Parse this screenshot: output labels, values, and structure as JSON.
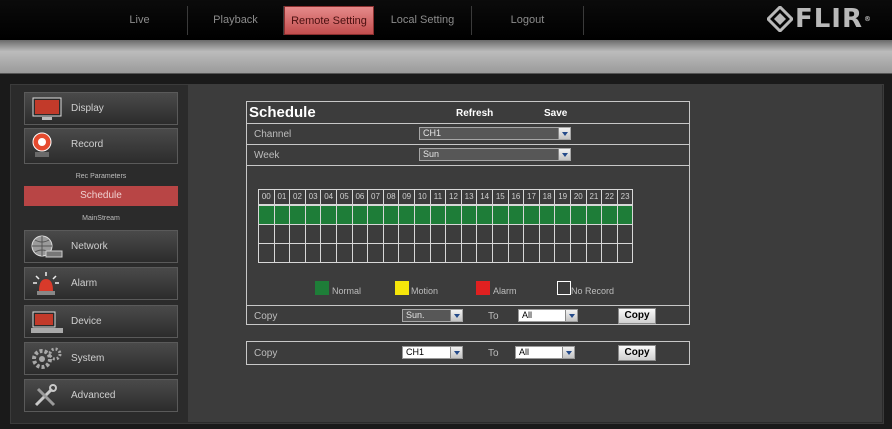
{
  "nav": {
    "tabs": [
      {
        "label": "Live"
      },
      {
        "label": "Playback"
      },
      {
        "label": "Remote Setting"
      },
      {
        "label": "Local Setting"
      },
      {
        "label": "Logout"
      }
    ],
    "active_tab": "Remote Setting",
    "logo_text": "FLIR",
    "logo_mark": "®"
  },
  "sidebar": {
    "items": [
      {
        "label": "Display",
        "icon": "monitor-icon"
      },
      {
        "label": "Record",
        "icon": "record-icon"
      },
      {
        "label": "Network",
        "icon": "globe-network-icon"
      },
      {
        "label": "Alarm",
        "icon": "alarm-siren-icon"
      },
      {
        "label": "Device",
        "icon": "device-icon"
      },
      {
        "label": "System",
        "icon": "gears-icon"
      },
      {
        "label": "Advanced",
        "icon": "tools-icon"
      }
    ],
    "record_sub": [
      {
        "label": "Rec Parameters"
      },
      {
        "label": "Schedule"
      },
      {
        "label": "MainStream"
      }
    ],
    "active_sub": "Schedule"
  },
  "schedule": {
    "title": "Schedule",
    "refresh_label": "Refresh",
    "save_label": "Save",
    "channel_label": "Channel",
    "channel_value": "CH1",
    "week_label": "Week",
    "week_value": "Sun",
    "hours": [
      "00",
      "01",
      "02",
      "03",
      "04",
      "05",
      "06",
      "07",
      "08",
      "09",
      "10",
      "11",
      "12",
      "13",
      "14",
      "15",
      "16",
      "17",
      "18",
      "19",
      "20",
      "21",
      "22",
      "23"
    ],
    "rows": [
      [
        "Normal",
        "Normal",
        "Normal",
        "Normal",
        "Normal",
        "Normal",
        "Normal",
        "Normal",
        "Normal",
        "Normal",
        "Normal",
        "Normal",
        "Normal",
        "Normal",
        "Normal",
        "Normal",
        "Normal",
        "Normal",
        "Normal",
        "Normal",
        "Normal",
        "Normal",
        "Normal",
        "Normal"
      ],
      [
        "No Record",
        "No Record",
        "No Record",
        "No Record",
        "No Record",
        "No Record",
        "No Record",
        "No Record",
        "No Record",
        "No Record",
        "No Record",
        "No Record",
        "No Record",
        "No Record",
        "No Record",
        "No Record",
        "No Record",
        "No Record",
        "No Record",
        "No Record",
        "No Record",
        "No Record",
        "No Record",
        "No Record"
      ],
      [
        "No Record",
        "No Record",
        "No Record",
        "No Record",
        "No Record",
        "No Record",
        "No Record",
        "No Record",
        "No Record",
        "No Record",
        "No Record",
        "No Record",
        "No Record",
        "No Record",
        "No Record",
        "No Record",
        "No Record",
        "No Record",
        "No Record",
        "No Record",
        "No Record",
        "No Record",
        "No Record",
        "No Record"
      ]
    ],
    "legend": [
      {
        "label": "Normal",
        "color": "#1e7d38"
      },
      {
        "label": "Motion",
        "color": "#f5e50a"
      },
      {
        "label": "Alarm",
        "color": "#e02020"
      },
      {
        "label": "No Record",
        "color": "#ffffff"
      }
    ],
    "copy_day": {
      "label": "Copy",
      "from_value": "Sun.",
      "to_label": "To",
      "to_value": "All",
      "button_label": "Copy"
    },
    "copy_channel": {
      "label": "Copy",
      "from_value": "CH1",
      "to_label": "To",
      "to_value": "All",
      "button_label": "Copy"
    }
  }
}
